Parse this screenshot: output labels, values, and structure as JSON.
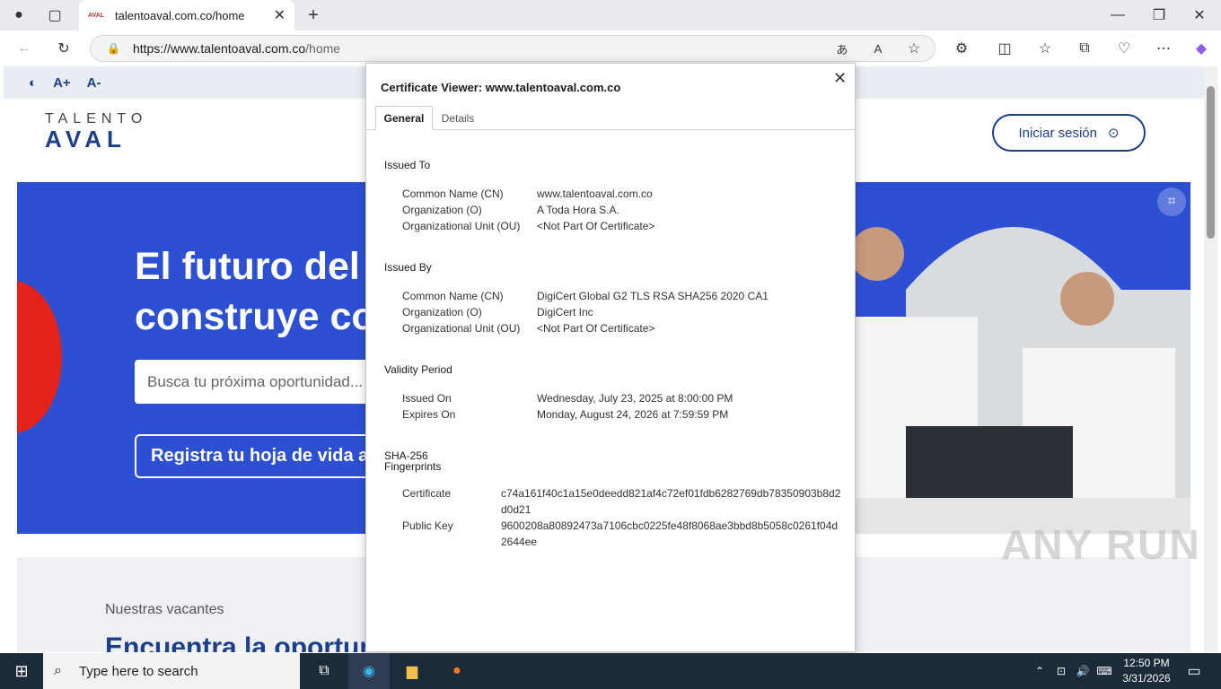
{
  "browser": {
    "tab_title": "talentoaval.com.co/home",
    "tab_favicon_text": "AVAL",
    "url_host": "https://www.talentoaval.com.co",
    "url_path": "/home"
  },
  "page": {
    "a11y": {
      "contrast_icon": "contrast-icon",
      "increase": "A+",
      "decrease": "A-"
    },
    "logo_top": "TALENTO",
    "logo_bottom": "AVAL",
    "login_label": "Iniciar sesión",
    "hero_title": "El futuro del p\nconstruye co",
    "search_placeholder": "Busca tu próxima oportunidad...",
    "cv_button": "Registra tu hoja de vida ac",
    "vacantes_sub": "Nuestras vacantes",
    "vacantes_title": "Encuentra la oportuni",
    "watermark": "ANY RUN"
  },
  "dialog": {
    "title": "Certificate Viewer: www.talentoaval.com.co",
    "tabs": [
      "General",
      "Details"
    ],
    "issued_to": {
      "heading": "Issued To",
      "rows": [
        {
          "k": "Common Name (CN)",
          "v": "www.talentoaval.com.co"
        },
        {
          "k": "Organization (O)",
          "v": "A Toda Hora S.A."
        },
        {
          "k": "Organizational Unit (OU)",
          "v": "<Not Part Of Certificate>"
        }
      ]
    },
    "issued_by": {
      "heading": "Issued By",
      "rows": [
        {
          "k": "Common Name (CN)",
          "v": "DigiCert Global G2 TLS RSA SHA256 2020 CA1"
        },
        {
          "k": "Organization (O)",
          "v": "DigiCert Inc"
        },
        {
          "k": "Organizational Unit (OU)",
          "v": "<Not Part Of Certificate>"
        }
      ]
    },
    "validity": {
      "heading": "Validity Period",
      "rows": [
        {
          "k": "Issued On",
          "v": "Wednesday, July 23, 2025 at 8:00:00 PM"
        },
        {
          "k": "Expires On",
          "v": "Monday, August 24, 2026 at 7:59:59 PM"
        }
      ]
    },
    "fingerprints": {
      "heading_line1": "SHA-256",
      "heading_line2": "Fingerprints",
      "rows": [
        {
          "k": "Certificate",
          "v": "c74a161f40c1a15e0deedd821af4c72ef01fdb6282769db78350903b8d2d0d21"
        },
        {
          "k": "Public Key",
          "v": "9600208a80892473a7106cbc0225fe48f8068ae3bbd8b5058c0261f04d2644ee"
        }
      ]
    }
  },
  "taskbar": {
    "search_placeholder": "Type here to search",
    "time": "12:50 PM",
    "date": "3/31/2026"
  },
  "colors": {
    "brand_blue": "#1d3e8c",
    "hero_blue": "#2d4fd2",
    "accent_red": "#e2231a"
  }
}
